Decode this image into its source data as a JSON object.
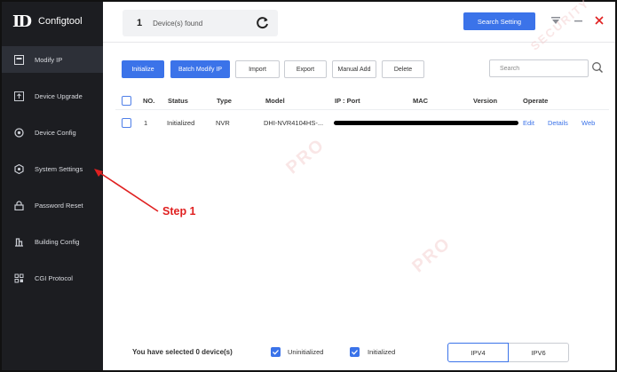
{
  "app": {
    "title": "Configtool",
    "logo_glyph": "ID"
  },
  "sidebar": {
    "items": [
      {
        "label": "Modify IP",
        "icon": "modify-ip-icon",
        "active": true
      },
      {
        "label": "Device Upgrade",
        "icon": "upgrade-icon"
      },
      {
        "label": "Device Config",
        "icon": "config-icon"
      },
      {
        "label": "System Settings",
        "icon": "system-settings-icon"
      },
      {
        "label": "Password Reset",
        "icon": "lock-icon"
      },
      {
        "label": "Building Config",
        "icon": "building-icon"
      },
      {
        "label": "CGI Protocol",
        "icon": "cgi-icon"
      }
    ]
  },
  "header": {
    "found_count": "1",
    "found_label": "Device(s) found",
    "search_setting_label": "Search Setting"
  },
  "toolbar": {
    "initialize": "Initialize",
    "batch_modify_ip": "Batch Modify IP",
    "import": "Import",
    "export": "Export",
    "manual_add": "Manual Add",
    "delete": "Delete",
    "search_placeholder": "Search"
  },
  "table": {
    "headers": [
      "NO.",
      "Status",
      "Type",
      "Model",
      "IP : Port",
      "MAC",
      "Version",
      "Operate"
    ],
    "rows": [
      {
        "no": "1",
        "status": "Initialized",
        "type": "NVR",
        "model": "DHI-NVR4104HS-...",
        "ops": [
          "Edit",
          "Details",
          "Web"
        ]
      }
    ]
  },
  "annotation": {
    "step": "Step 1"
  },
  "watermark": {
    "lines": [
      "PRO",
      "SECURITY"
    ]
  },
  "footer": {
    "selected_text": "You have selected 0  device(s)",
    "uninitialized_label": "Uninitialized",
    "initialized_label": "Initialized",
    "ipv4": "IPV4",
    "ipv6": "IPV6"
  },
  "colors": {
    "accent": "#3b73e9",
    "sidebar_bg": "#1c1d21",
    "annotation": "#e02020"
  }
}
